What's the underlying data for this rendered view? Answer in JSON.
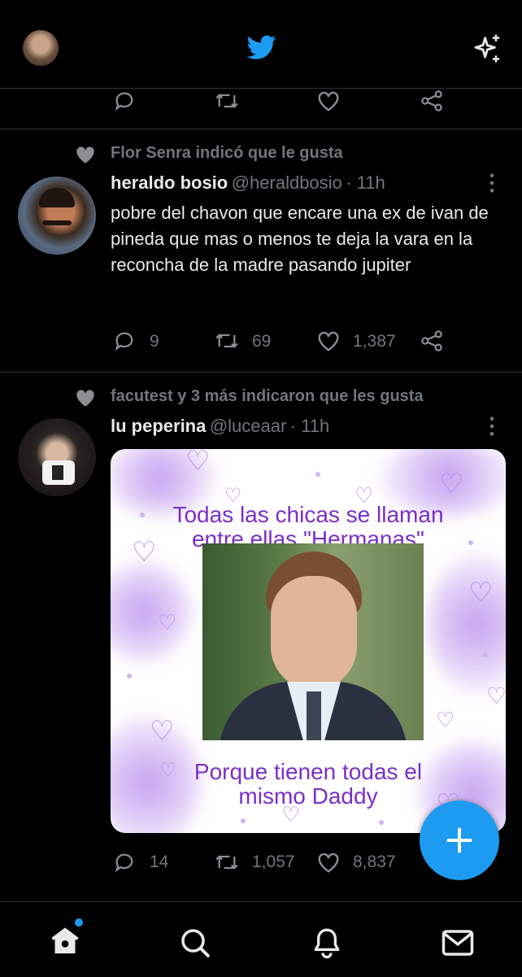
{
  "header": {
    "logo_icon": "twitter-bird-icon",
    "sparkle_icon": "sparkle-icon",
    "brand_color": "#1d9bf0"
  },
  "tweets": [
    {
      "context": "Flor Senra indicó que le gusta",
      "name": "heraldo bosio",
      "handle": "@heraldbosio",
      "time": "· 11h",
      "text": "pobre del chavon que encare una ex de ivan de pineda que mas o menos te deja la vara en la reconcha de la madre pasando jupiter",
      "replies": "9",
      "retweets": "69",
      "likes": "1,387"
    },
    {
      "context": "facutest y 3 más indicaron que les gusta",
      "name": "lu peperina",
      "handle": "@luceaar",
      "time": "· 11h",
      "media": {
        "top_text": "Todas las chicas se llaman entre ellas \"Hermanas\"",
        "bottom_text": "Porque tienen todas el mismo Daddy"
      },
      "replies": "14",
      "retweets": "1,057",
      "likes": "8,837"
    }
  ],
  "nav": {
    "items": [
      "home-icon",
      "search-icon",
      "notifications-icon",
      "messages-icon"
    ],
    "active": "home-icon",
    "badge_color": "#1d9bf0"
  },
  "fab_icon": "compose-plus-icon"
}
